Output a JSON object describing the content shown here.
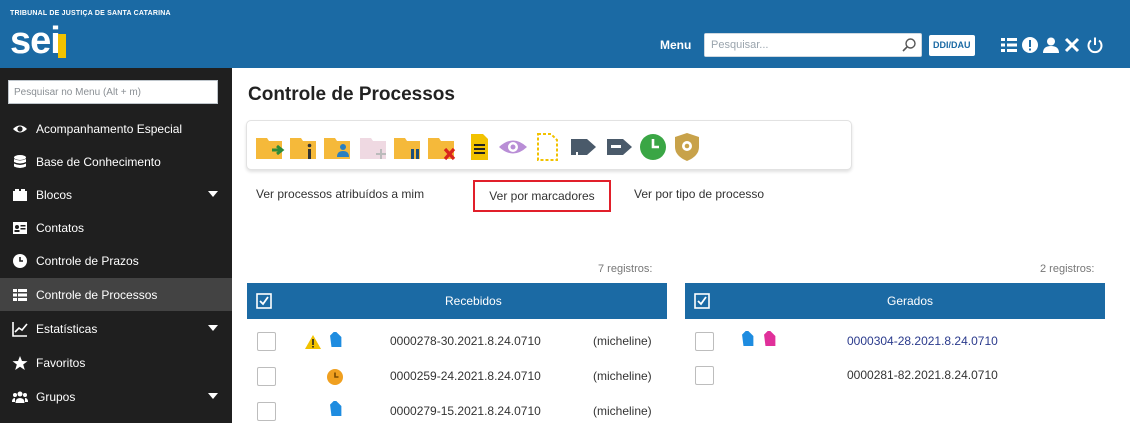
{
  "header": {
    "org_name": "TRIBUNAL DE JUSTIÇA DE SANTA CATARINA",
    "logo_text": "sei",
    "menu_label": "Menu",
    "search_placeholder": "Pesquisar...",
    "ddi_button": "DDI/DAU",
    "icons": [
      "list-icon",
      "info-icon",
      "user-icon",
      "tools-icon",
      "power-icon"
    ],
    "color": "#1b6aa4"
  },
  "sidebar": {
    "search_placeholder": "Pesquisar no Menu (Alt + m)",
    "items": [
      {
        "label": "Acompanhamento Especial",
        "icon": "eye-icon"
      },
      {
        "label": "Base de Conhecimento",
        "icon": "database-icon"
      },
      {
        "label": "Blocos",
        "icon": "blocks-icon",
        "expandable": true
      },
      {
        "label": "Contatos",
        "icon": "contact-card-icon"
      },
      {
        "label": "Controle de Prazos",
        "icon": "clock-icon"
      },
      {
        "label": "Controle de Processos",
        "icon": "list-icon",
        "active": true
      },
      {
        "label": "Estatísticas",
        "icon": "chart-icon",
        "expandable": true
      },
      {
        "label": "Favoritos",
        "icon": "star-icon"
      },
      {
        "label": "Grupos",
        "icon": "group-icon",
        "expandable": true
      }
    ]
  },
  "main": {
    "title": "Controle de Processos",
    "toolbar_icons": [
      "send-process-icon",
      "info-process-icon",
      "assign-process-icon",
      "new-process-icon",
      "pause-process-icon",
      "delete-process-icon",
      "document-icon",
      "view-icon",
      "blank-document-icon",
      "add-marker-icon",
      "marker-icon",
      "deadline-clock-icon",
      "shield-icon"
    ],
    "filters": {
      "atribuidos": "Ver processos atribuídos a mim",
      "marcadores": "Ver por marcadores",
      "tipo": "Ver por tipo de processo"
    },
    "recebidos": {
      "count": "7 registros:",
      "title": "Recebidos",
      "rows": [
        {
          "process": "0000278-30.2021.8.24.0710",
          "user": "(micheline)",
          "markers": [
            "warning-icon",
            "blue-tag-icon"
          ]
        },
        {
          "process": "0000259-24.2021.8.24.0710",
          "user": "(micheline)",
          "markers": [
            "orange-clock-icon"
          ]
        },
        {
          "process": "0000279-15.2021.8.24.0710",
          "user": "(micheline)",
          "markers": [
            "blue-tag-icon"
          ]
        }
      ]
    },
    "gerados": {
      "count": "2 registros:",
      "title": "Gerados",
      "rows": [
        {
          "process": "0000304-28.2021.8.24.0710",
          "markers": [
            "blue-tag-icon",
            "pink-tag-icon"
          ]
        },
        {
          "process": "0000281-82.2021.8.24.0710",
          "markers": []
        }
      ]
    }
  }
}
